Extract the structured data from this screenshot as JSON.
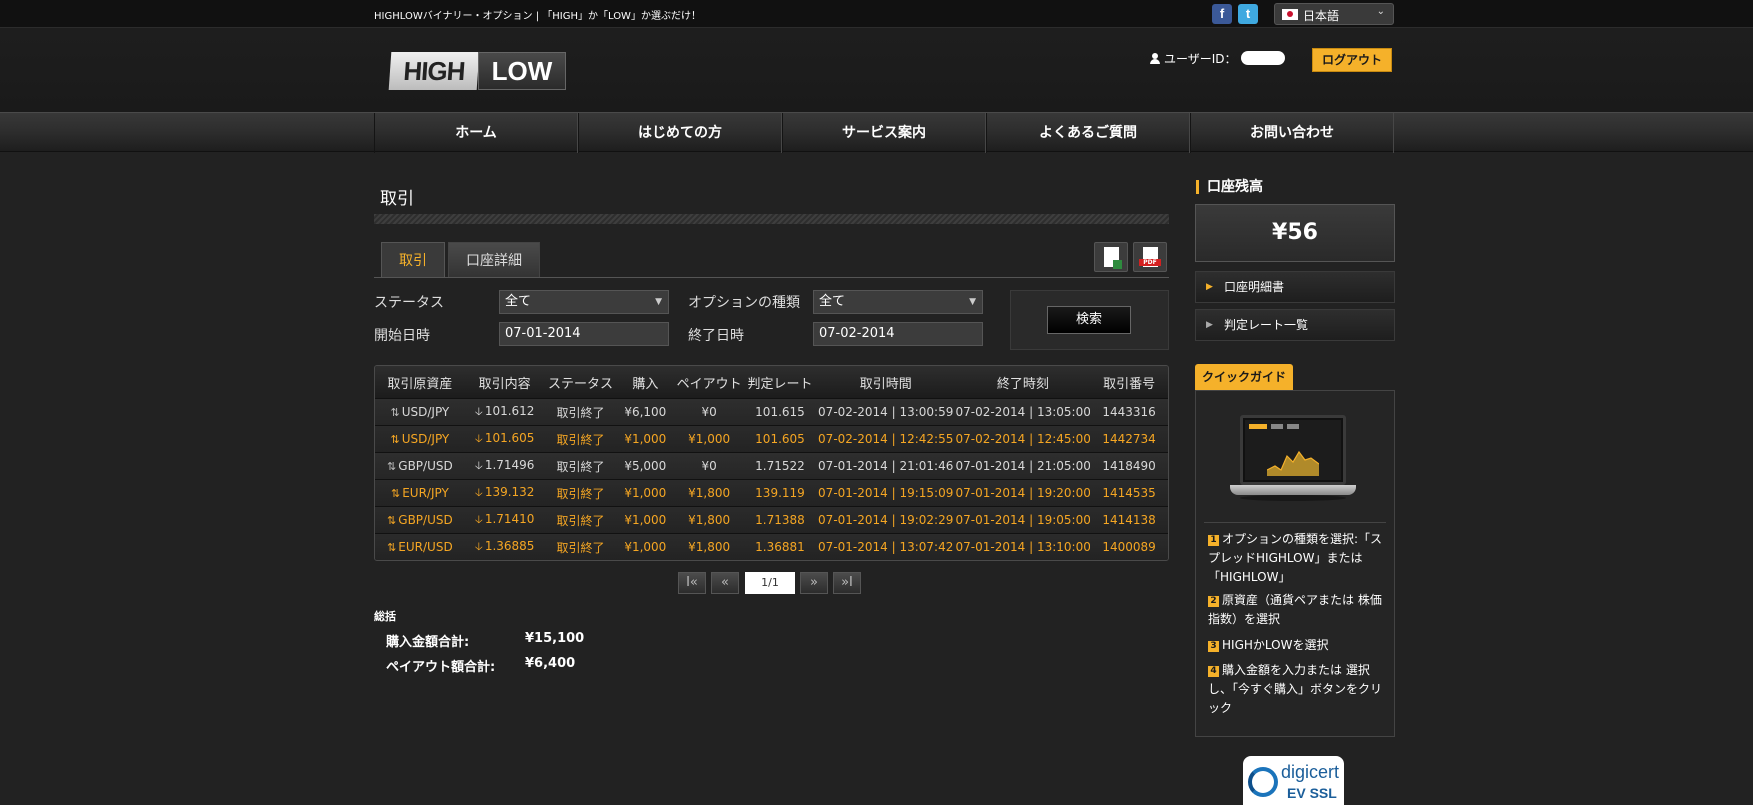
{
  "topbar": {
    "tagline": "HIGHLOWバイナリー・オプション | 「HIGH」か「LOW」か選ぶだけ！",
    "facebook_icon": "f",
    "twitter_icon": "t",
    "language": "日本語",
    "language_chevron": "⌄"
  },
  "header": {
    "logo_high": "HIGH",
    "logo_low": "LOW",
    "user_label": "ユーザーID：",
    "logout": "ログアウト"
  },
  "nav": [
    {
      "label": "ホーム"
    },
    {
      "label": "はじめての方"
    },
    {
      "label": "サービス案内"
    },
    {
      "label": "よくあるご質問"
    },
    {
      "label": "お問い合わせ"
    }
  ],
  "main": {
    "title": "取引",
    "tabs": [
      {
        "label": "取引"
      },
      {
        "label": "口座詳細"
      }
    ],
    "filters": {
      "status_label": "ステータス",
      "status_value": "全て",
      "option_type_label": "オプションの種類",
      "option_type_value": "全て",
      "start_label": "開始日時",
      "start_value": "07-01-2014",
      "end_label": "終了日時",
      "end_value": "07-02-2014",
      "search": "検索",
      "select_arrow": "▼"
    },
    "table": {
      "headers": [
        "取引原資産",
        "取引内容",
        "ステータス",
        "購入",
        "ペイアウト",
        "判定レート",
        "取引時間",
        "終了時刻",
        "取引番号"
      ],
      "updown_icon": "⇅",
      "down_icon": "🡣",
      "rows": [
        {
          "asset": "USD/JPY",
          "rate": "101.612",
          "status": "取引終了",
          "purchase": "¥6,100",
          "payout": "¥0",
          "judge": "101.615",
          "time": "07-02-2014 | 13:00:59",
          "end": "07-02-2014 | 13:05:00",
          "id": "1443316",
          "style": "grey"
        },
        {
          "asset": "USD/JPY",
          "rate": "101.605",
          "status": "取引終了",
          "purchase": "¥1,000",
          "payout": "¥1,000",
          "judge": "101.605",
          "time": "07-02-2014 | 12:42:55",
          "end": "07-02-2014 | 12:45:00",
          "id": "1442734",
          "style": "orange"
        },
        {
          "asset": "GBP/USD",
          "rate": "1.71496",
          "status": "取引終了",
          "purchase": "¥5,000",
          "payout": "¥0",
          "judge": "1.71522",
          "time": "07-01-2014 | 21:01:46",
          "end": "07-01-2014 | 21:05:00",
          "id": "1418490",
          "style": "grey"
        },
        {
          "asset": "EUR/JPY",
          "rate": "139.132",
          "status": "取引終了",
          "purchase": "¥1,000",
          "payout": "¥1,800",
          "judge": "139.119",
          "time": "07-01-2014 | 19:15:09",
          "end": "07-01-2014 | 19:20:00",
          "id": "1414535",
          "style": "orange"
        },
        {
          "asset": "GBP/USD",
          "rate": "1.71410",
          "status": "取引終了",
          "purchase": "¥1,000",
          "payout": "¥1,800",
          "judge": "1.71388",
          "time": "07-01-2014 | 19:02:29",
          "end": "07-01-2014 | 19:05:00",
          "id": "1414138",
          "style": "orange"
        },
        {
          "asset": "EUR/USD",
          "rate": "1.36885",
          "status": "取引終了",
          "purchase": "¥1,000",
          "payout": "¥1,800",
          "judge": "1.36881",
          "time": "07-01-2014 | 13:07:42",
          "end": "07-01-2014 | 13:10:00",
          "id": "1400089",
          "style": "orange"
        }
      ]
    },
    "pagination": {
      "first": "I«",
      "prev": "«",
      "current": "1/1",
      "next": "»",
      "last": "»I"
    },
    "summary": {
      "title": "総括",
      "purchase_label": "購入金額合計:",
      "purchase_value": "¥15,100",
      "payout_label": "ペイアウト額合計:",
      "payout_value": "¥6,400"
    }
  },
  "sidebar": {
    "balance_heading": "口座残高",
    "balance": "¥56",
    "link_triangle": "▶",
    "links": [
      {
        "label": "口座明細書"
      },
      {
        "label": "判定レート一覧"
      }
    ],
    "quick_guide": "クイックガイド",
    "steps": [
      {
        "num": "1",
        "text": "オプションの種類を選択:「スプレッドHIGHLOW」または「HIGHLOW」"
      },
      {
        "num": "2",
        "text": "原資産（通貨ペアまたは 株価指数）を選択"
      },
      {
        "num": "3",
        "text": "HIGHかLOWを選択"
      },
      {
        "num": "4",
        "text": "購入金額を入力または 選択し、「今すぐ購入」ボタンをクリック"
      }
    ],
    "ssl_brand": "digicert",
    "ssl_sub": "EV SSL"
  },
  "colors": {
    "accent": "#f5b12a",
    "background": "#222222",
    "row_orange_text": "#f5a623"
  }
}
